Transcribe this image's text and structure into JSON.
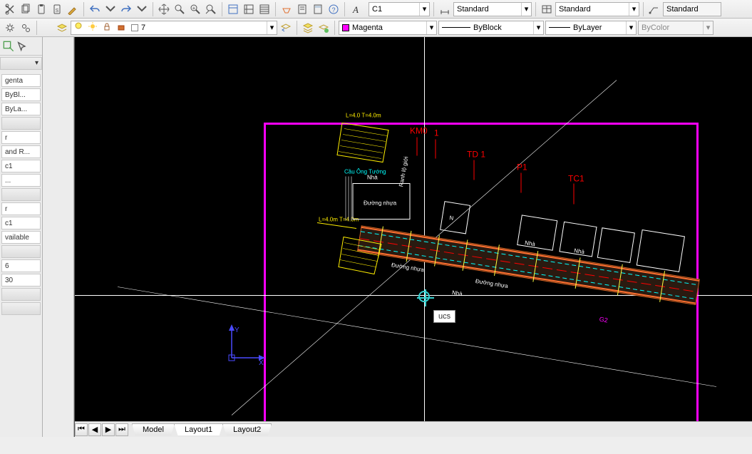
{
  "toolbar1": {
    "styleDropdown": "C1",
    "std1": "Standard",
    "std2": "Standard",
    "std3": "Standard"
  },
  "toolbar2": {
    "layerCombo": "7",
    "color": {
      "label": "Magenta"
    },
    "linetype": {
      "label": "ByBlock"
    },
    "lineweight": {
      "label": "ByLayer"
    },
    "plotstyle": {
      "label": "ByColor"
    }
  },
  "leftPanel": {
    "items": [
      "genta",
      "ByBl...",
      "ByLa...",
      "",
      "r",
      "and R...",
      "c1",
      "...",
      "",
      "r",
      "c1",
      "vailable",
      "",
      "6",
      "30",
      "",
      ""
    ]
  },
  "drawing": {
    "labels": {
      "km0": "KM0",
      "one": "1",
      "td1": "TD 1",
      "p1": "P1",
      "tc1": "TC1",
      "ucs": "ucs",
      "y": "Y",
      "x": "X"
    }
  },
  "tabs": {
    "items": [
      "Model",
      "Layout1",
      "Layout2"
    ],
    "active": 1
  }
}
